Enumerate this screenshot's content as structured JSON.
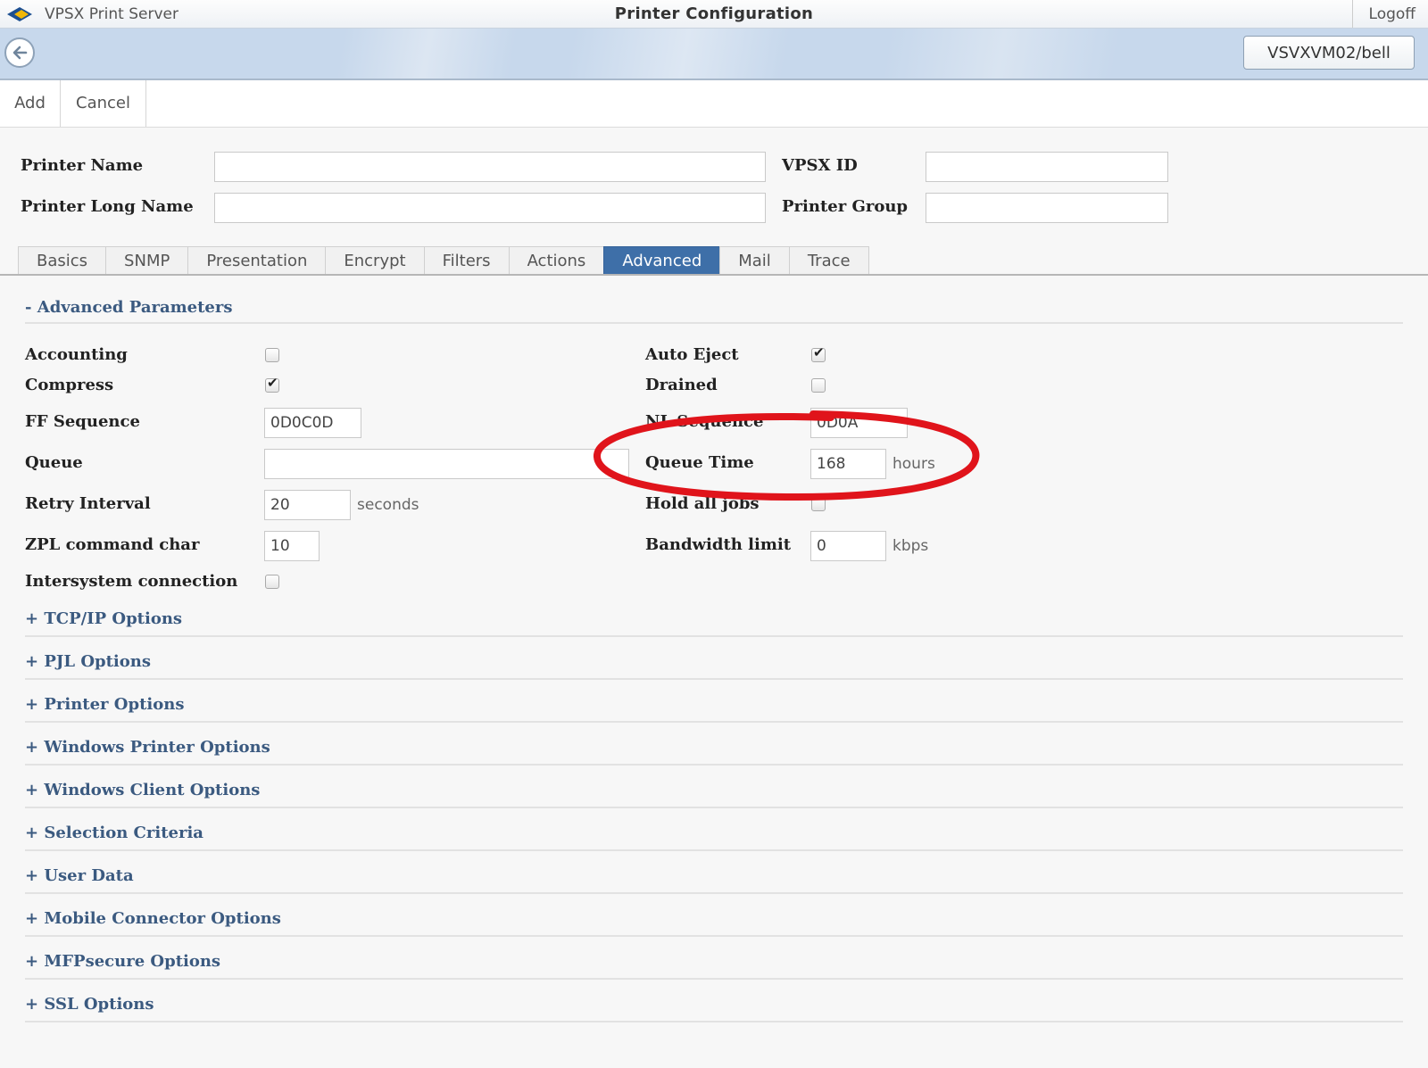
{
  "titlebar": {
    "app_name": "VPSX Print Server",
    "title": "Printer Configuration",
    "logoff": "Logoff"
  },
  "navbar": {
    "user": "VSVXVM02/bell"
  },
  "toolbar": {
    "add": "Add",
    "cancel": "Cancel"
  },
  "header_form": {
    "printer_name_label": "Printer Name",
    "printer_long_name_label": "Printer Long Name",
    "vpsx_id_label": "VPSX ID",
    "printer_group_label": "Printer Group",
    "printer_name": "",
    "printer_long_name": "",
    "vpsx_id": "",
    "printer_group": ""
  },
  "tabs": [
    "Basics",
    "SNMP",
    "Presentation",
    "Encrypt",
    "Filters",
    "Actions",
    "Advanced",
    "Mail",
    "Trace"
  ],
  "active_tab": "Advanced",
  "advanced": {
    "section_title": "- Advanced Parameters",
    "left": {
      "accounting_label": "Accounting",
      "accounting": false,
      "compress_label": "Compress",
      "compress": true,
      "ff_sequence_label": "FF Sequence",
      "ff_sequence": "0D0C0D",
      "queue_label": "Queue",
      "queue": "",
      "retry_interval_label": "Retry Interval",
      "retry_interval": "20",
      "retry_unit": "seconds",
      "zpl_label": "ZPL command char",
      "zpl": "10",
      "intersystem_label": "Intersystem connection",
      "intersystem": false
    },
    "right": {
      "auto_eject_label": "Auto Eject",
      "auto_eject": true,
      "drained_label": "Drained",
      "drained": false,
      "nl_sequence_label": "NL Sequence",
      "nl_sequence": "0D0A",
      "queue_time_label": "Queue Time",
      "queue_time": "168",
      "queue_time_unit": "hours",
      "hold_all_jobs_label": "Hold all jobs",
      "hold_all_jobs": false,
      "bandwidth_label": "Bandwidth limit",
      "bandwidth": "0",
      "bandwidth_unit": "kbps"
    }
  },
  "collapsed_sections": [
    "+ TCP/IP Options",
    "+ PJL Options",
    "+ Printer Options",
    "+ Windows Printer Options",
    "+ Windows Client Options",
    "+ Selection Criteria",
    "+ User Data",
    "+ Mobile Connector Options",
    "+ MFPsecure Options",
    "+ SSL Options"
  ],
  "colors": {
    "accent": "#3e6fa8",
    "annotation": "#e0141b",
    "section_text": "#3b5a80"
  }
}
